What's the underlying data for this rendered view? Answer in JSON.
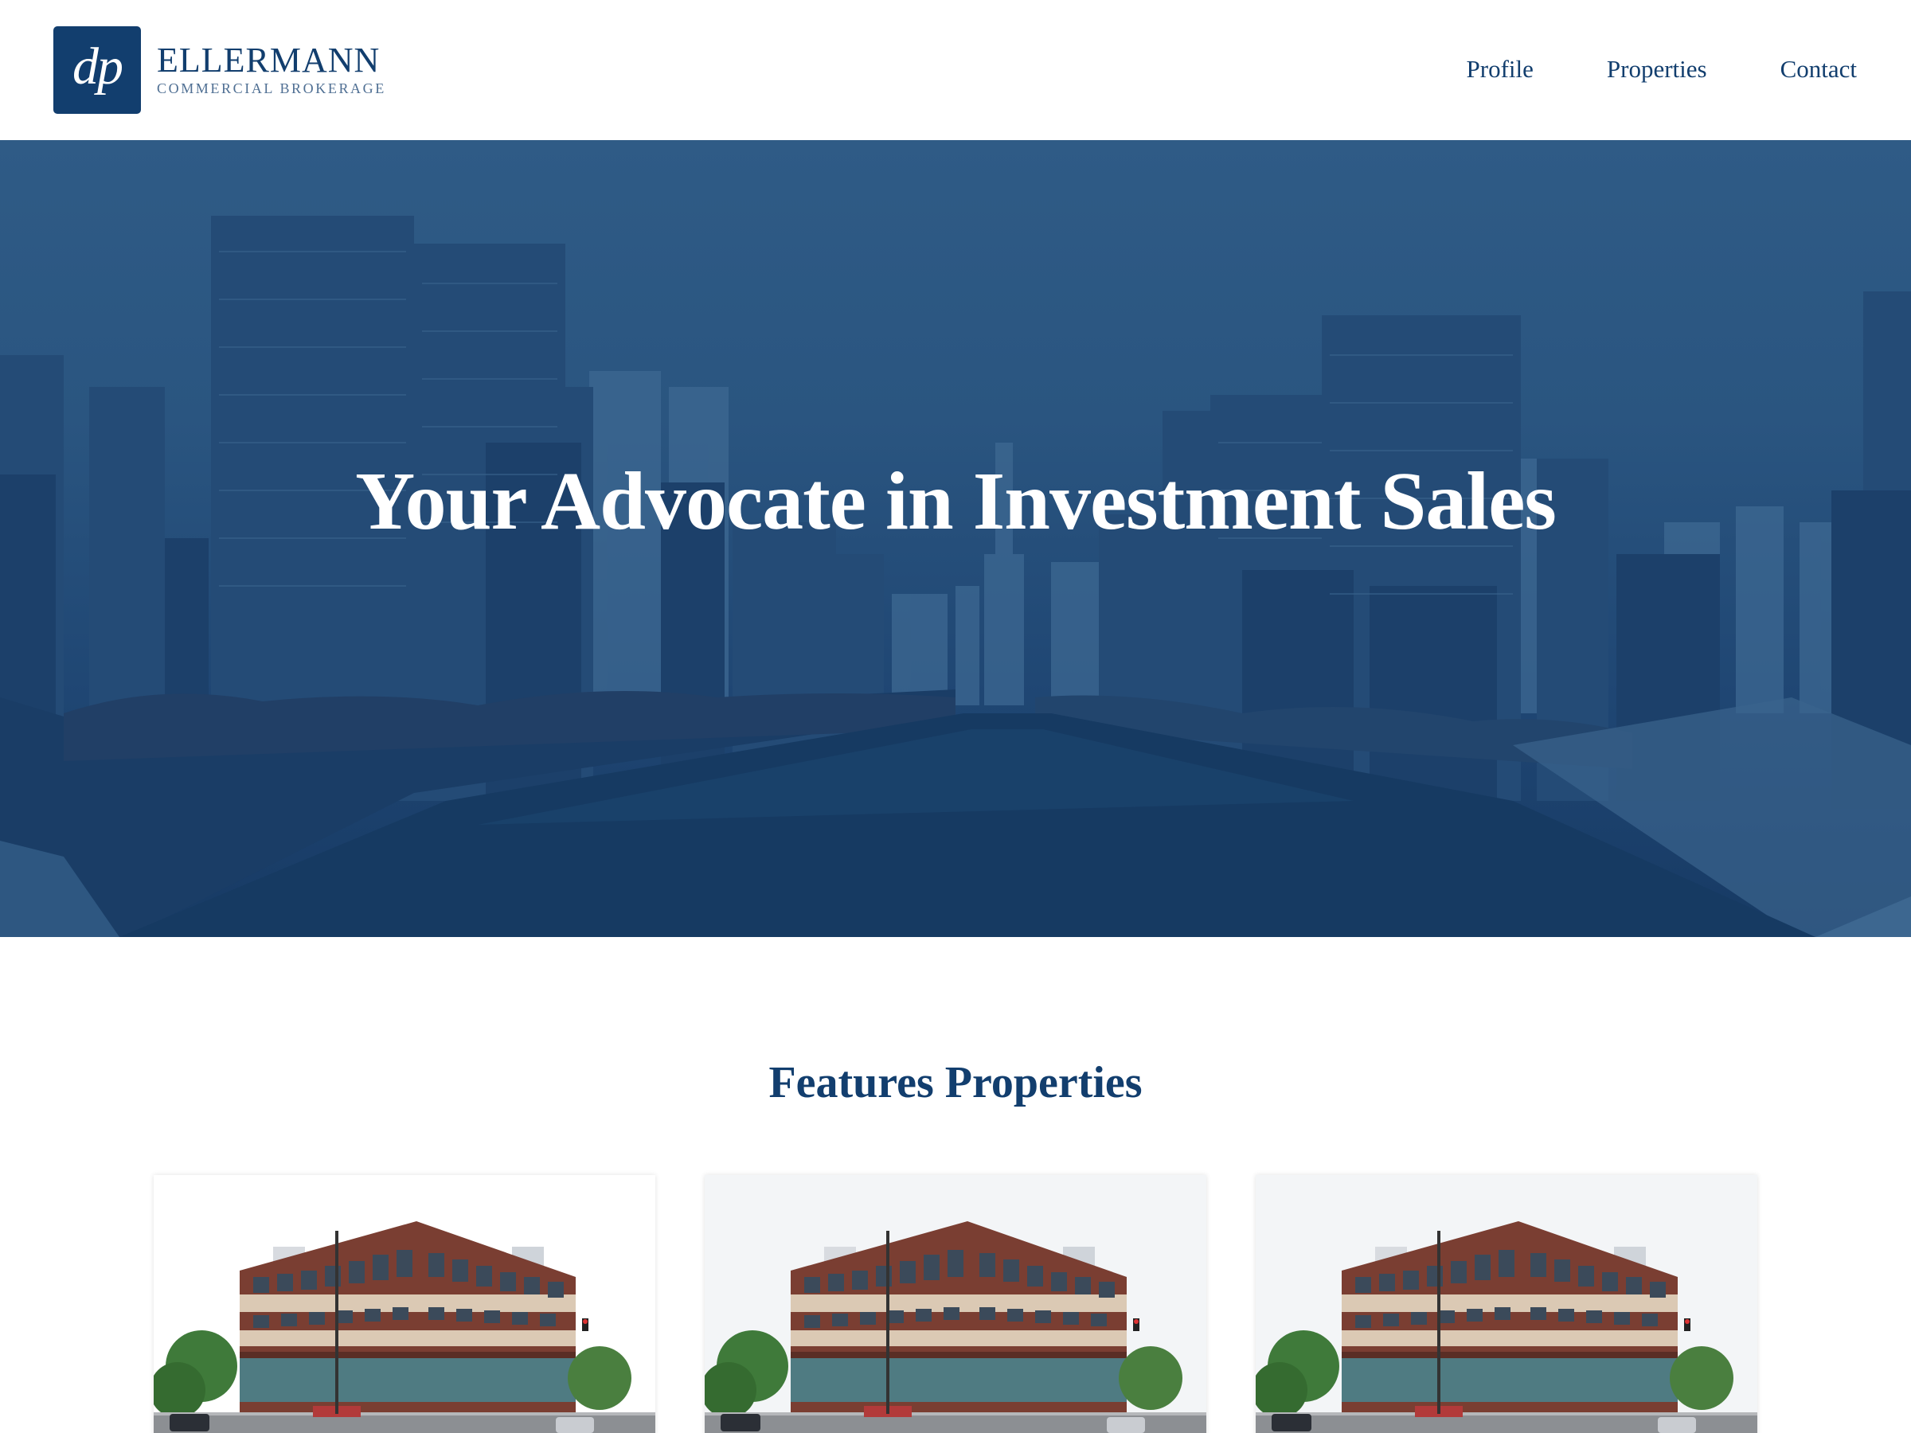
{
  "brand": {
    "monogram": "dp",
    "name": "ELLERMANN",
    "tagline": "COMMERCIAL BROKERAGE",
    "color": "#123e6e"
  },
  "nav": {
    "items": [
      {
        "label": "Profile"
      },
      {
        "label": "Properties"
      },
      {
        "label": "Contact"
      }
    ]
  },
  "hero": {
    "title": "Your Advocate in Investment Sales",
    "image": "city-river-skyline",
    "overlay_color": "#1f4673"
  },
  "featured": {
    "title": "Features Properties",
    "cards": [
      {
        "image": "brick-office-building"
      },
      {
        "image": "brick-office-building"
      },
      {
        "image": "brick-office-building"
      }
    ]
  }
}
